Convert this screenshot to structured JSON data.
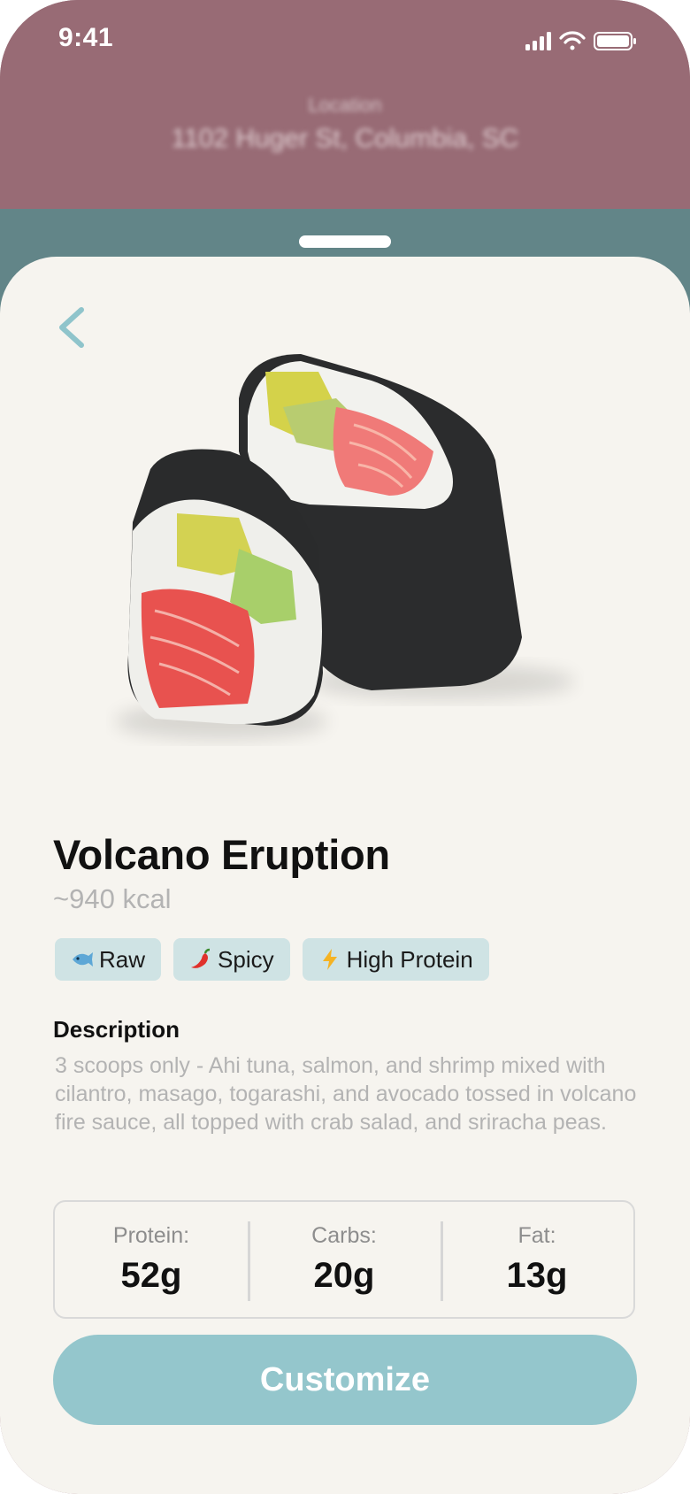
{
  "status_bar": {
    "time": "9:41"
  },
  "background": {
    "location_label": "Location",
    "location_value": "1102 Huger St, Columbia, SC"
  },
  "item": {
    "name": "Volcano Eruption",
    "calories": "~940 kcal",
    "tags": [
      {
        "icon": "fish-icon",
        "label": "Raw"
      },
      {
        "icon": "chili-pepper-icon",
        "label": "Spicy"
      },
      {
        "icon": "lightning-icon",
        "label": "High Protein"
      }
    ],
    "description_heading": "Description",
    "description": "3 scoops only - Ahi tuna, salmon, and shrimp mixed with cilantro, masago, togarashi, and avocado tossed in volcano fire sauce, all topped with crab salad, and sriracha peas.",
    "macros": [
      {
        "label": "Protein:",
        "value": "52g"
      },
      {
        "label": "Carbs:",
        "value": "20g"
      },
      {
        "label": "Fat:",
        "value": "13g"
      }
    ]
  },
  "actions": {
    "customize_label": "Customize"
  },
  "colors": {
    "accent": "#94c6cc",
    "tag_bg": "#cfe3e4",
    "sheet_bg": "#f6f4ef",
    "header_bg": "#986b75",
    "back_chevron": "#8fc4cb"
  }
}
